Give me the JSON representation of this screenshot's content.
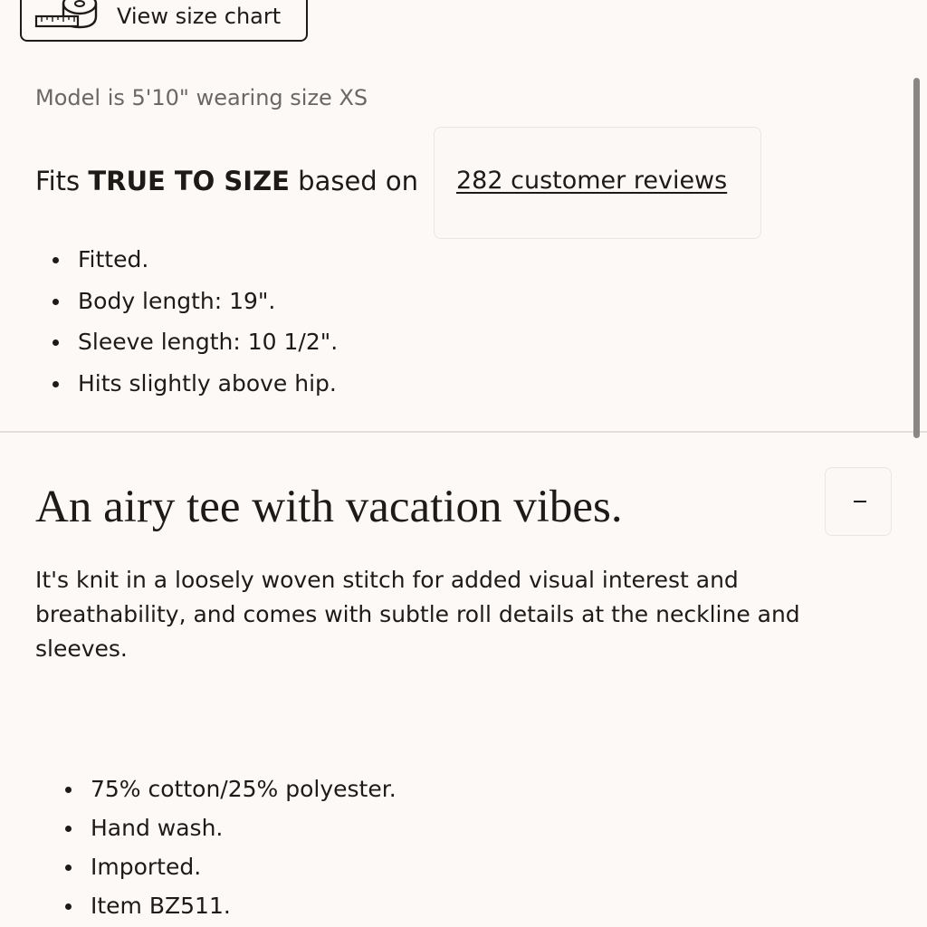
{
  "size_chart": {
    "label": "View size chart",
    "icon": "measuring-tape-icon"
  },
  "model_note": "Model is 5'10\" wearing size XS",
  "fit": {
    "prefix": "Fits ",
    "rating": "TRUE TO SIZE",
    "suffix": " based on",
    "reviews_link": "282 customer reviews"
  },
  "fit_details": [
    "Fitted.",
    "Body length: 19\".",
    "Sleeve length: 10 1/2\".",
    "Hits slightly above hip."
  ],
  "product": {
    "headline": "An airy tee with vacation vibes.",
    "collapse_icon": "minus-icon",
    "collapse_label": "-",
    "description": "It's knit in a loosely woven stitch for added visual interest and breathability, and comes with subtle roll details at the neckline and sleeves."
  },
  "specs": [
    "75% cotton/25% polyester.",
    "Hand wash.",
    "Imported.",
    "Item BZ511."
  ],
  "colors": {
    "background": "#fcf9f7",
    "text": "#1d1b1a",
    "muted_text": "#6b6764",
    "divider": "#e3dedb"
  }
}
